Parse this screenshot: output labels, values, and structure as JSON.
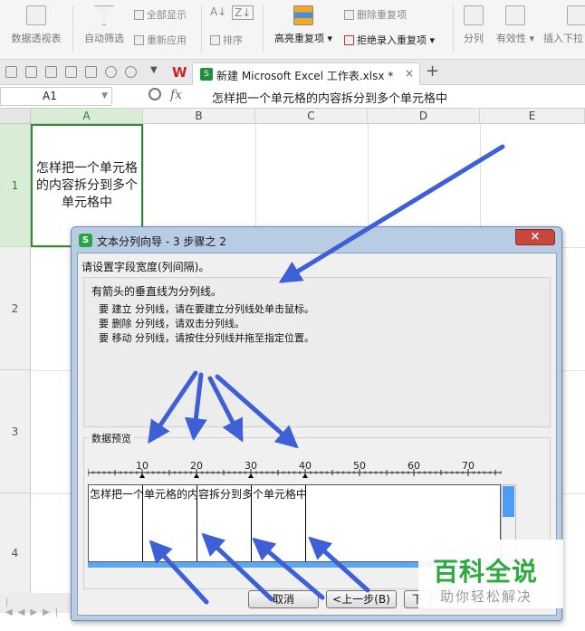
{
  "ribbon": {
    "pivot_table": "数据透视表",
    "auto_filter": "自动筛选",
    "show_all": "全部显示",
    "reapply": "重新应用",
    "sort_az": "A↓",
    "sort_za": "Z↓",
    "sort": "排序",
    "highlight_dup": "高亮重复项",
    "delete_dup": "删除重复项",
    "reject_dup": "拒绝录入重复项",
    "split_column": "分列",
    "validity": "有效性",
    "insert_dropdown": "插入下拉"
  },
  "tabbar": {
    "wps_logo": "W",
    "doc_name": "新建 Microsoft Excel 工作表.xlsx *",
    "close": "×",
    "add": "+"
  },
  "formula_bar": {
    "cell_ref": "A1",
    "fx": "fx",
    "value": "怎样把一个单元格的内容拆分到多个单元格中"
  },
  "grid": {
    "columns": [
      "A",
      "B",
      "C",
      "D",
      "E"
    ],
    "rows": [
      "1",
      "2",
      "3",
      "4"
    ],
    "a1_text": "怎样把一个单元格的内容拆分到多个单元格中"
  },
  "dialog": {
    "app_icon": "S",
    "title": "文本分列向导 - 3 步骤之 2",
    "close": "×",
    "instruction": "请设置字段宽度(列间隔)。",
    "info_head": "有箭头的垂直线为分列线。",
    "info_lines": [
      "要 建立 分列线，请在要建立分列线处单击鼠标。",
      "要 删除 分列线，请双击分列线。",
      "要 移动 分列线，请按住分列线并拖至指定位置。"
    ],
    "preview_label": "数据预览",
    "ruler_numbers": [
      "10",
      "20",
      "30",
      "40",
      "50",
      "60",
      "70"
    ],
    "preview_text": "怎样把一个单元格的内容拆分到多个单元格中",
    "cancel": "取消",
    "back": "<上一步(B)",
    "next": "下"
  },
  "watermark": {
    "main": "百科全说",
    "sub": "助你轻松解决"
  },
  "colors": {
    "selection_green": "#2e8b2e",
    "arrow_blue": "#3e5fd6",
    "watermark_green": "#2eaa3c",
    "scroll_blue": "#4d9df6"
  }
}
